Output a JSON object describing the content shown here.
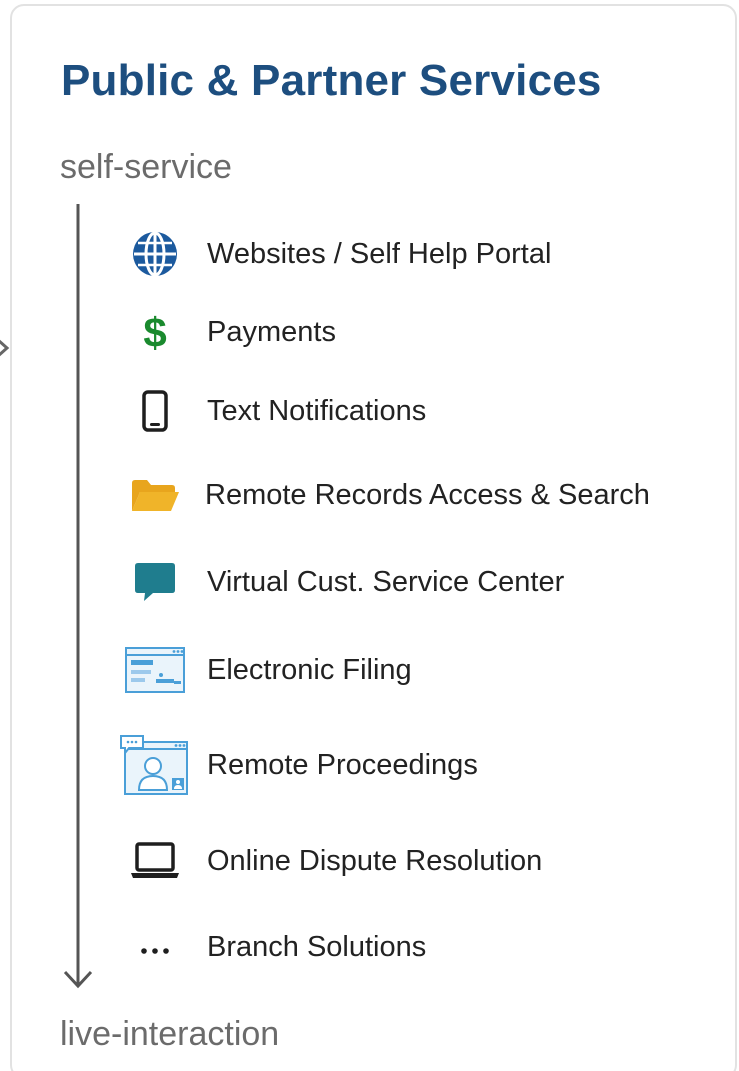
{
  "header": {
    "title": "Public & Partner Services"
  },
  "scale": {
    "start_label": "self-service",
    "end_label": "live-interaction"
  },
  "items": [
    {
      "label": "Websites / Self Help Portal",
      "icon": "globe-icon"
    },
    {
      "label": "Payments",
      "icon": "dollar-icon"
    },
    {
      "label": "Text Notifications",
      "icon": "mobile-phone-icon"
    },
    {
      "label": "Remote Records Access &  Search",
      "icon": "folder-icon"
    },
    {
      "label": "Virtual  Cust. Service Center",
      "icon": "chat-bubble-icon"
    },
    {
      "label": "Electronic Filing",
      "icon": "web-form-icon"
    },
    {
      "label": "Remote Proceedings",
      "icon": "video-call-icon"
    },
    {
      "label": "Online Dispute Resolution",
      "icon": "laptop-icon"
    },
    {
      "label": "Branch Solutions",
      "icon": "ellipsis-icon"
    }
  ],
  "colors": {
    "title": "#1d4e7f",
    "globe": "#1c5a9e",
    "dollar": "#1a8a2e",
    "folder": "#e8a51d",
    "chat": "#1f7d8e",
    "screen": "#4a9fd8"
  }
}
